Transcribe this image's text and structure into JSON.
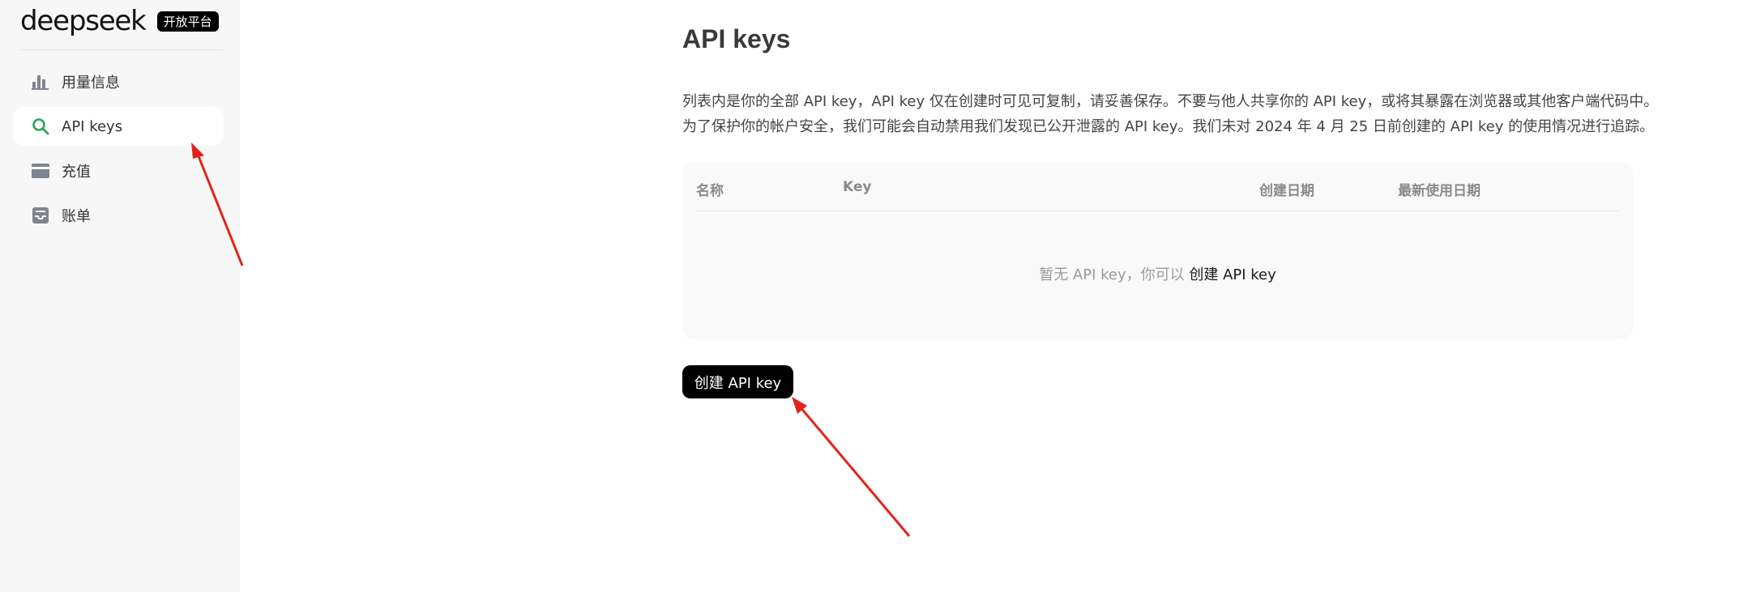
{
  "brand": {
    "logo_text": "deepseek",
    "badge": "开放平台"
  },
  "sidebar": {
    "items": [
      {
        "label": "用量信息",
        "icon": "bar-chart-icon",
        "active": false
      },
      {
        "label": "API keys",
        "icon": "search-icon",
        "active": true
      },
      {
        "label": "充值",
        "icon": "card-icon",
        "active": false
      },
      {
        "label": "账单",
        "icon": "inbox-icon",
        "active": false
      }
    ]
  },
  "main": {
    "title": "API keys",
    "description_line1": "列表内是你的全部 API key，API key 仅在创建时可见可复制，请妥善保存。不要与他人共享你的 API key，或将其暴露在浏览器或其他客户端代码中。",
    "description_line2": "为了保护你的帐户安全，我们可能会自动禁用我们发现已公开泄露的 API key。我们未对 2024 年 4 月 25 日前创建的 API key 的使用情况进行追踪。",
    "table": {
      "columns": [
        "名称",
        "Key",
        "创建日期",
        "最新使用日期"
      ],
      "empty_text": "暂无 API key，你可以 ",
      "empty_link": "创建 API key"
    },
    "create_button": "创建 API key"
  },
  "colors": {
    "sidebar_bg": "#f7f7f7",
    "accent_green": "#2aa35a",
    "annotation_red": "#e0241b",
    "button_bg": "#000000"
  }
}
